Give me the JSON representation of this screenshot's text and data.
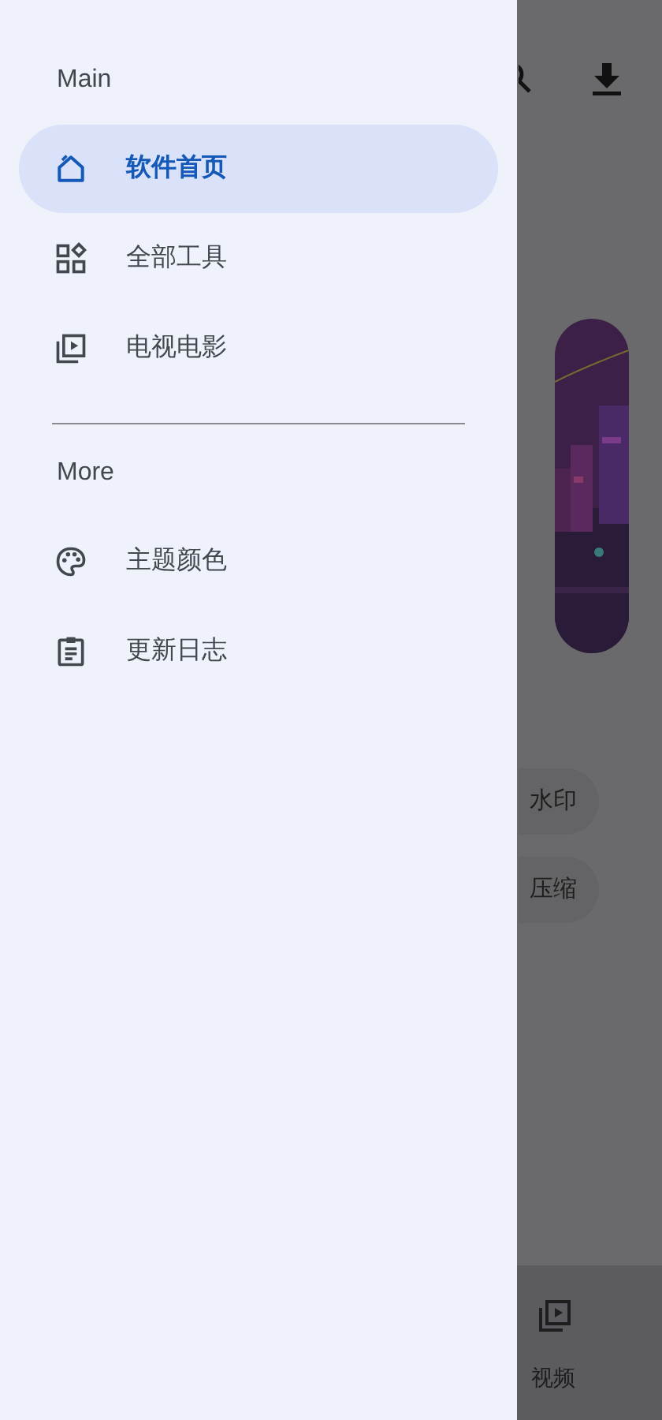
{
  "drawer": {
    "sections": [
      {
        "header": "Main",
        "items": [
          {
            "label": "软件首页",
            "selected": true
          },
          {
            "label": "全部工具",
            "selected": false
          },
          {
            "label": "电视电影",
            "selected": false
          }
        ]
      },
      {
        "header": "More",
        "items": [
          {
            "label": "主题颜色",
            "selected": false
          },
          {
            "label": "更新日志",
            "selected": false
          }
        ]
      }
    ]
  },
  "background": {
    "chips": [
      "水印",
      "压缩"
    ],
    "banner": {
      "kind": "picture"
    },
    "bottom_nav": {
      "label": "视频"
    }
  }
}
